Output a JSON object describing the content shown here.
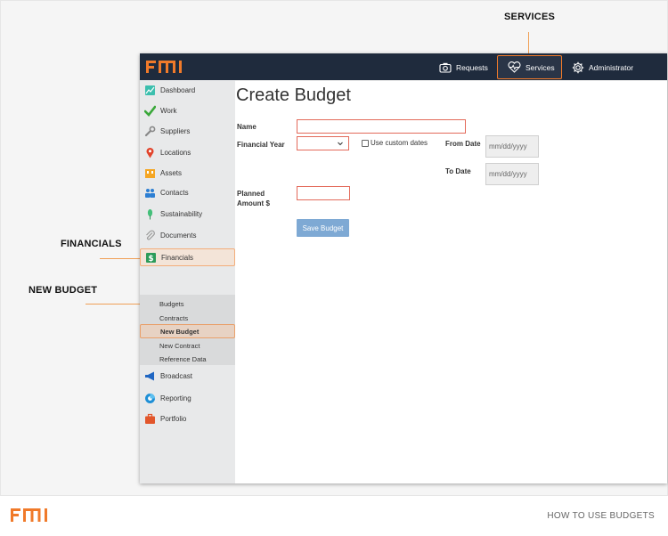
{
  "callouts": {
    "services": "SERVICES",
    "financials": "FINANCIALS",
    "new_budget": "NEW BUDGET"
  },
  "brand": {
    "logo_text": "FMI",
    "accent_color": "#f07a2a",
    "topbar_color": "#1f2b3d"
  },
  "topnav": {
    "requests": "Requests",
    "services": "Services",
    "administrator": "Administrator"
  },
  "sidebar": {
    "items": [
      {
        "label": "Dashboard",
        "icon": "dashboard-icon"
      },
      {
        "label": "Work",
        "icon": "check-icon"
      },
      {
        "label": "Suppliers",
        "icon": "wrench-icon"
      },
      {
        "label": "Locations",
        "icon": "map-pin-icon"
      },
      {
        "label": "Assets",
        "icon": "assets-icon"
      },
      {
        "label": "Contacts",
        "icon": "people-icon"
      },
      {
        "label": "Sustainability",
        "icon": "leaf-icon"
      },
      {
        "label": "Documents",
        "icon": "paperclip-icon"
      },
      {
        "label": "Financials",
        "icon": "dollar-icon"
      },
      {
        "label": "Broadcast",
        "icon": "megaphone-icon"
      },
      {
        "label": "Reporting",
        "icon": "chart-icon"
      },
      {
        "label": "Portfolio",
        "icon": "briefcase-icon"
      }
    ],
    "submenu": [
      "Budgets",
      "Contracts",
      "New Budget",
      "New Contract",
      "Reference Data"
    ]
  },
  "form": {
    "title": "Create Budget",
    "name_label": "Name",
    "name_value": "",
    "financial_year_label": "Financial Year",
    "financial_year_value": "",
    "custom_dates_label": "Use custom dates",
    "from_date_label": "From Date",
    "from_date_placeholder": "mm/dd/yyyy",
    "to_date_label": "To Date",
    "to_date_placeholder": "mm/dd/yyyy",
    "planned_label_line1": "Planned",
    "planned_label_line2": "Amount $",
    "planned_value": "",
    "save_button": "Save Budget"
  },
  "footer": {
    "logo_text": "FMI",
    "caption": "HOW TO USE BUDGETS"
  }
}
